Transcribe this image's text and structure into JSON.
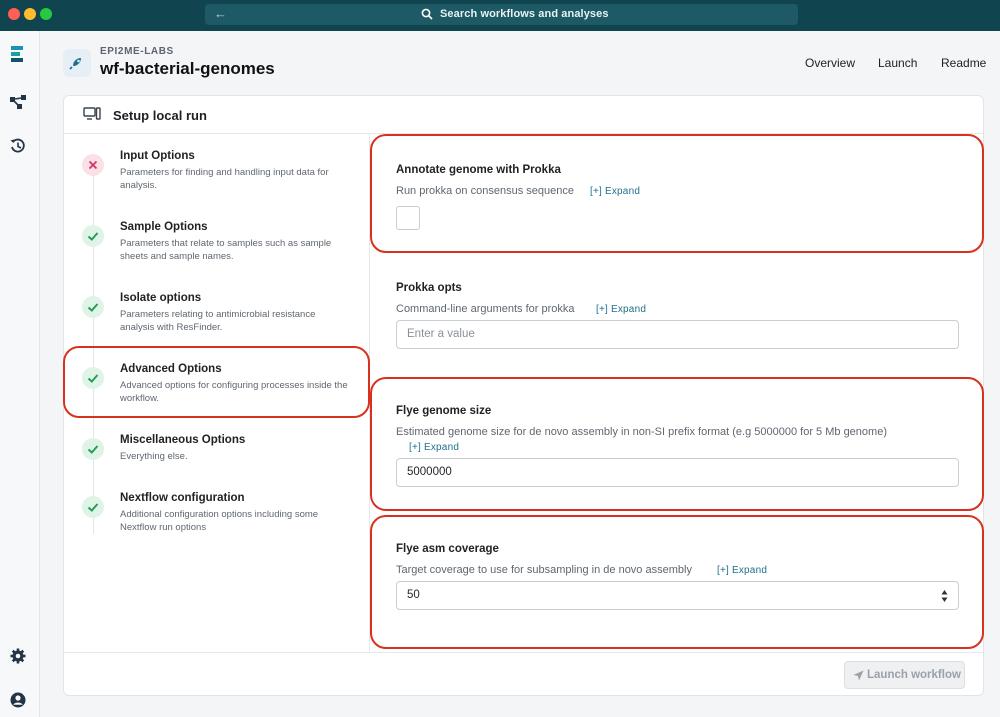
{
  "window": {
    "search_placeholder": "Search workflows and analyses",
    "back_icon": "arrow-left-icon",
    "search_icon": "search-icon"
  },
  "rail": {
    "icons": [
      "epi2me-logo-icon",
      "workflow-icon",
      "history-icon",
      "settings-icon",
      "account-icon"
    ]
  },
  "header": {
    "org": "EPI2ME-LABS",
    "title": "wf-bacterial-genomes",
    "nav": [
      "Overview",
      "Launch",
      "Readme"
    ]
  },
  "card": {
    "title": "Setup local run",
    "steps": [
      {
        "title": "Input Options",
        "desc": "Parameters for finding and handling input data for analysis.",
        "status": "error"
      },
      {
        "title": "Sample Options",
        "desc": "Parameters that relate to samples such as sample sheets and sample names.",
        "status": "ok"
      },
      {
        "title": "Isolate options",
        "desc": "Parameters relating to antimicrobial resistance analysis with ResFinder.",
        "status": "ok"
      },
      {
        "title": "Advanced Options",
        "desc": "Advanced options for configuring processes inside the workflow.",
        "status": "ok"
      },
      {
        "title": "Miscellaneous Options",
        "desc": "Everything else.",
        "status": "ok"
      },
      {
        "title": "Nextflow configuration",
        "desc": "Additional configuration options including some Nextflow run options",
        "status": "ok"
      }
    ],
    "fields": {
      "prokka": {
        "title": "Annotate genome with Prokka",
        "desc": "Run prokka on consensus sequence",
        "expand": "[+]  Expand",
        "checked": false
      },
      "prokka_opts": {
        "title": "Prokka opts",
        "desc": "Command-line arguments for prokka",
        "expand": "[+]  Expand",
        "placeholder": "Enter a value"
      },
      "flye_genome_size": {
        "title": "Flye genome size",
        "desc": "Estimated genome size for de novo assembly in non-SI prefix format (e.g 5000000 for 5 Mb genome)",
        "expand": "[+]  Expand",
        "value": "5000000"
      },
      "flye_asm_coverage": {
        "title": "Flye asm coverage",
        "desc": "Target coverage to use for subsampling in de novo assembly",
        "expand": "[+]  Expand",
        "value": "50"
      }
    },
    "launch_label": "Launch workflow"
  },
  "colors": {
    "titlebar": "#10454f",
    "accent": "#1f6f8b",
    "ok": "#1f9d55",
    "error": "#d6336c",
    "highlight": "#d8321f"
  }
}
